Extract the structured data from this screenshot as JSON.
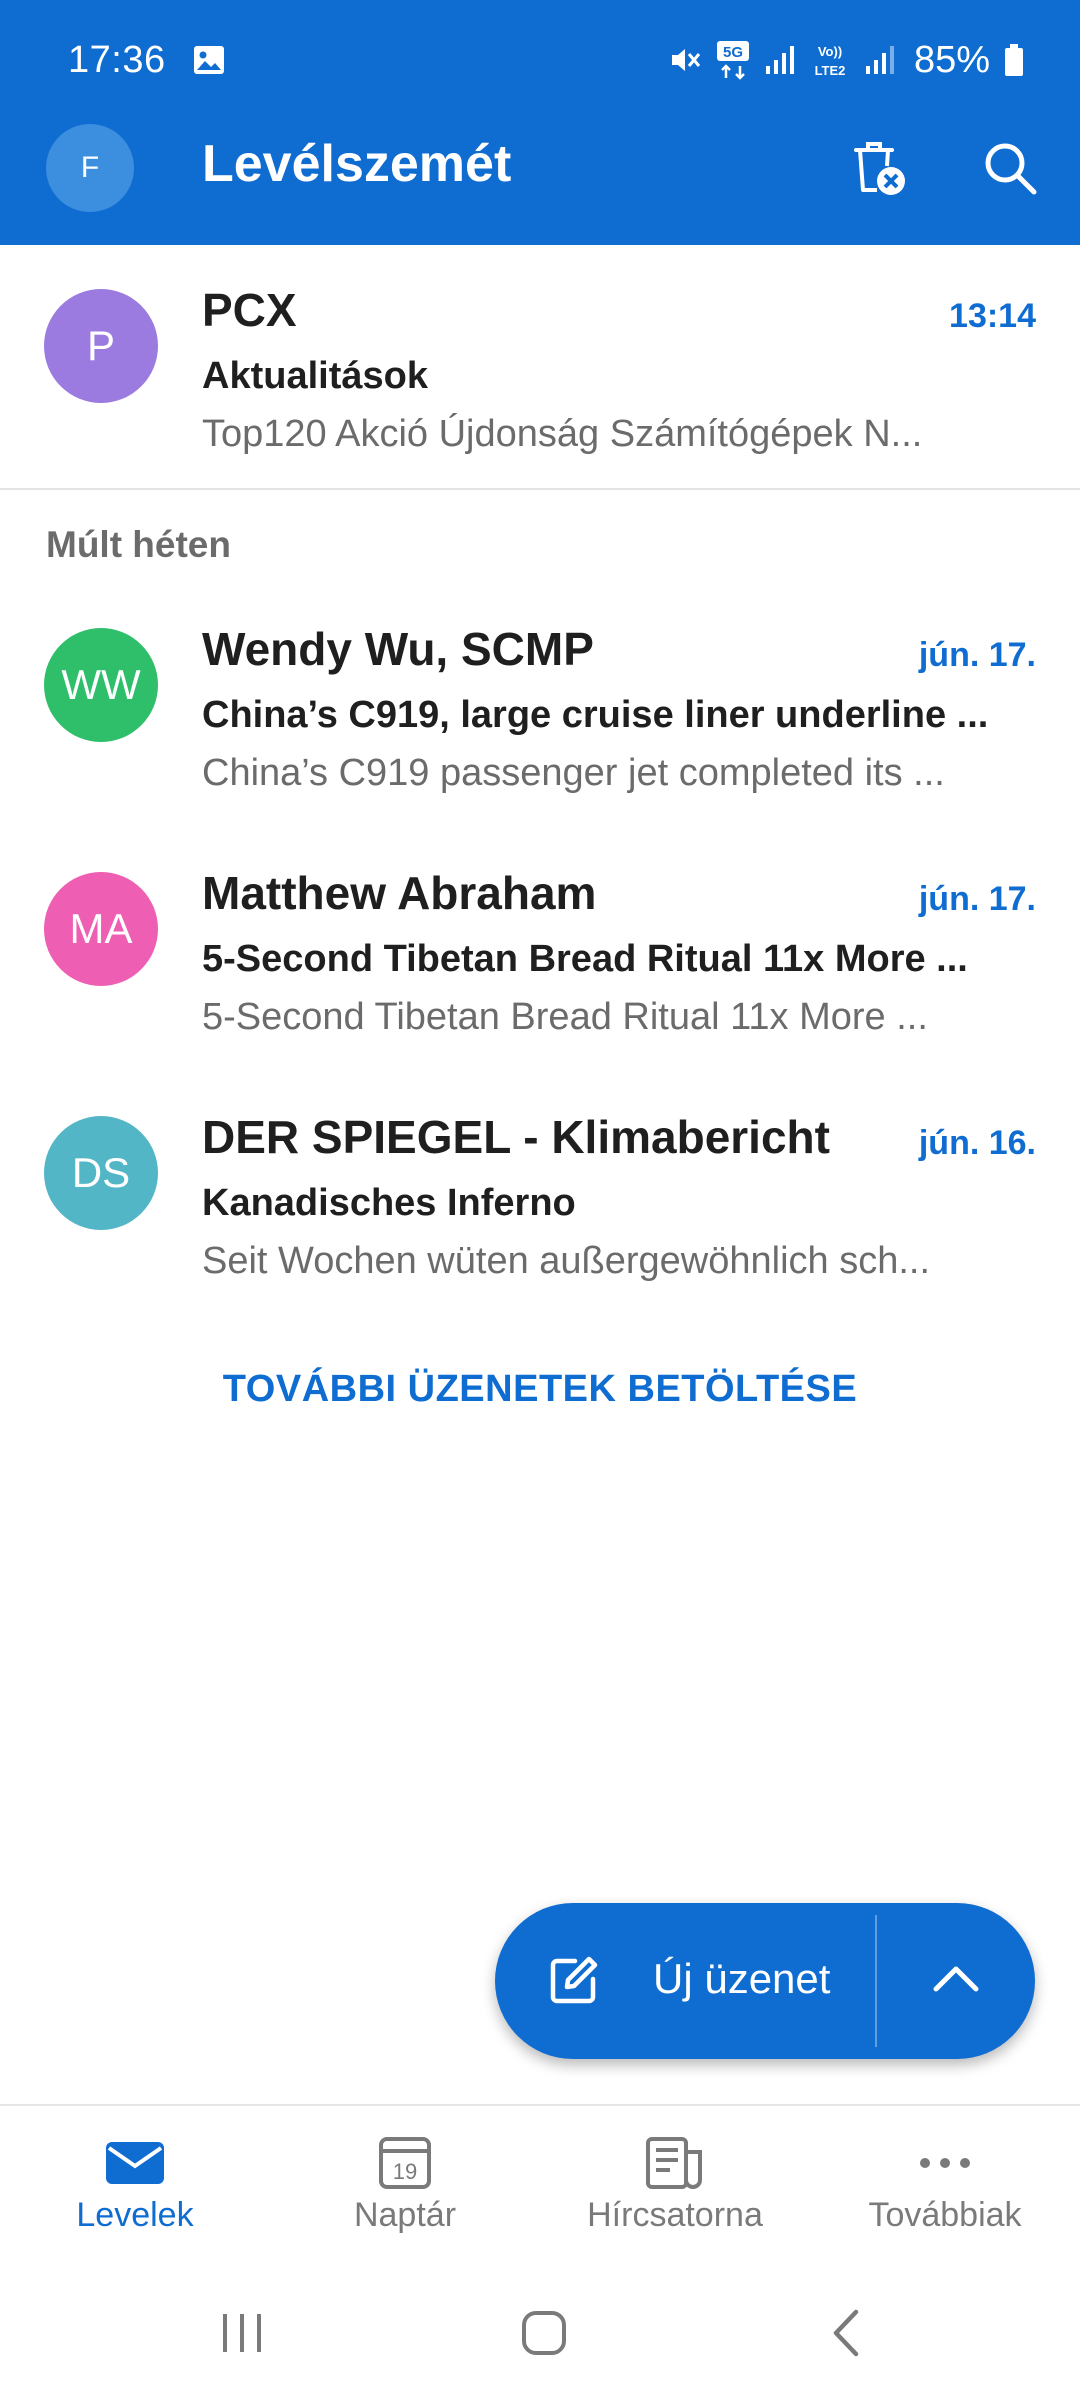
{
  "status_bar": {
    "time": "17:36",
    "battery": "85%",
    "icons": [
      "image-notification-icon",
      "mute-icon",
      "5g-icon",
      "signal-icon",
      "volte-lte2-icon",
      "signal-icon",
      "battery-icon"
    ]
  },
  "app_bar": {
    "account_initial": "F",
    "title": "Levélszemét",
    "actions": [
      "empty-trash-icon",
      "search-icon"
    ]
  },
  "colors": {
    "brand": "#0f6cd1",
    "avatar_p": "#9b7be0",
    "avatar_ww": "#2fbf6a",
    "avatar_ma": "#ee5fb4",
    "avatar_ds": "#52b6c6"
  },
  "messages": [
    {
      "initials": "P",
      "sender": "PCX",
      "date": "13:14",
      "subject": "Aktualitások",
      "preview": "Top120 Akció Újdonság Számítógépek N..."
    }
  ],
  "section_last_week": {
    "title": "Múlt héten",
    "messages": [
      {
        "initials": "WW",
        "sender": "Wendy Wu, SCMP",
        "date": "jún. 17.",
        "subject": "China’s C919, large cruise liner underline ...",
        "preview": "China’s C919 passenger jet completed its ..."
      },
      {
        "initials": "MA",
        "sender": "Matthew Abraham",
        "date": "jún. 17.",
        "subject": "5-Second Tibetan Bread Ritual 11x More ...",
        "preview": "5-Second Tibetan Bread Ritual 11x More ..."
      },
      {
        "initials": "DS",
        "sender": "DER SPIEGEL - Klimabericht",
        "date": "jún. 16.",
        "subject": "Kanadisches Inferno",
        "preview": "Seit Wochen wüten außergewöhnlich sch..."
      }
    ]
  },
  "load_more": "TOVÁBBI ÜZENETEK BETÖLTÉSE",
  "fab": {
    "label": "Új üzenet"
  },
  "bottom_nav": {
    "items": [
      {
        "label": "Levelek",
        "icon": "mail-icon",
        "active": true
      },
      {
        "label": "Naptár",
        "icon": "calendar-icon",
        "calendar_day": "19"
      },
      {
        "label": "Hírcsatorna",
        "icon": "feed-icon"
      },
      {
        "label": "Továbbiak",
        "icon": "more-icon"
      }
    ]
  }
}
